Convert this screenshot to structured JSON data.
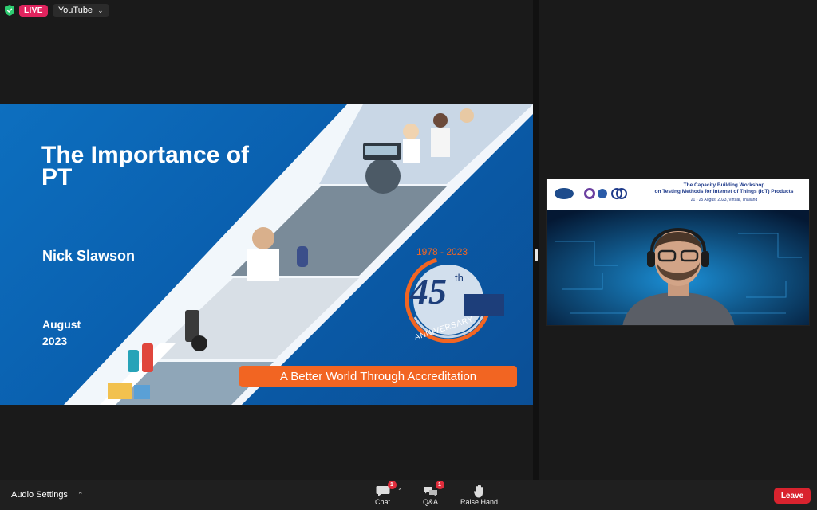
{
  "top": {
    "live_label": "LIVE",
    "stream_target": "YouTube"
  },
  "slide": {
    "title": "The Importance of PT",
    "presenter": "Nick Slawson",
    "date": "August 2023",
    "tagline": "A Better World Through Accreditation",
    "anniversary": {
      "years": "1978 - 2023",
      "number": "45",
      "suffix": "th",
      "word": "ANNIVERSARY"
    },
    "colors": {
      "blue": "#0a5fae",
      "orange": "#f26522"
    }
  },
  "video_panel": {
    "banner_line1": "The Capacity Building Workshop",
    "banner_line2": "on Testing Methods for Internet of Things (IoT) Products",
    "banner_line3": "21 - 25 August 2023, Virtual, Thailand"
  },
  "toolbar": {
    "audio_settings": "Audio Settings",
    "chat_label": "Chat",
    "chat_badge": "1",
    "qa_label": "Q&A",
    "qa_badge": "1",
    "raise_hand_label": "Raise Hand",
    "leave_label": "Leave"
  }
}
